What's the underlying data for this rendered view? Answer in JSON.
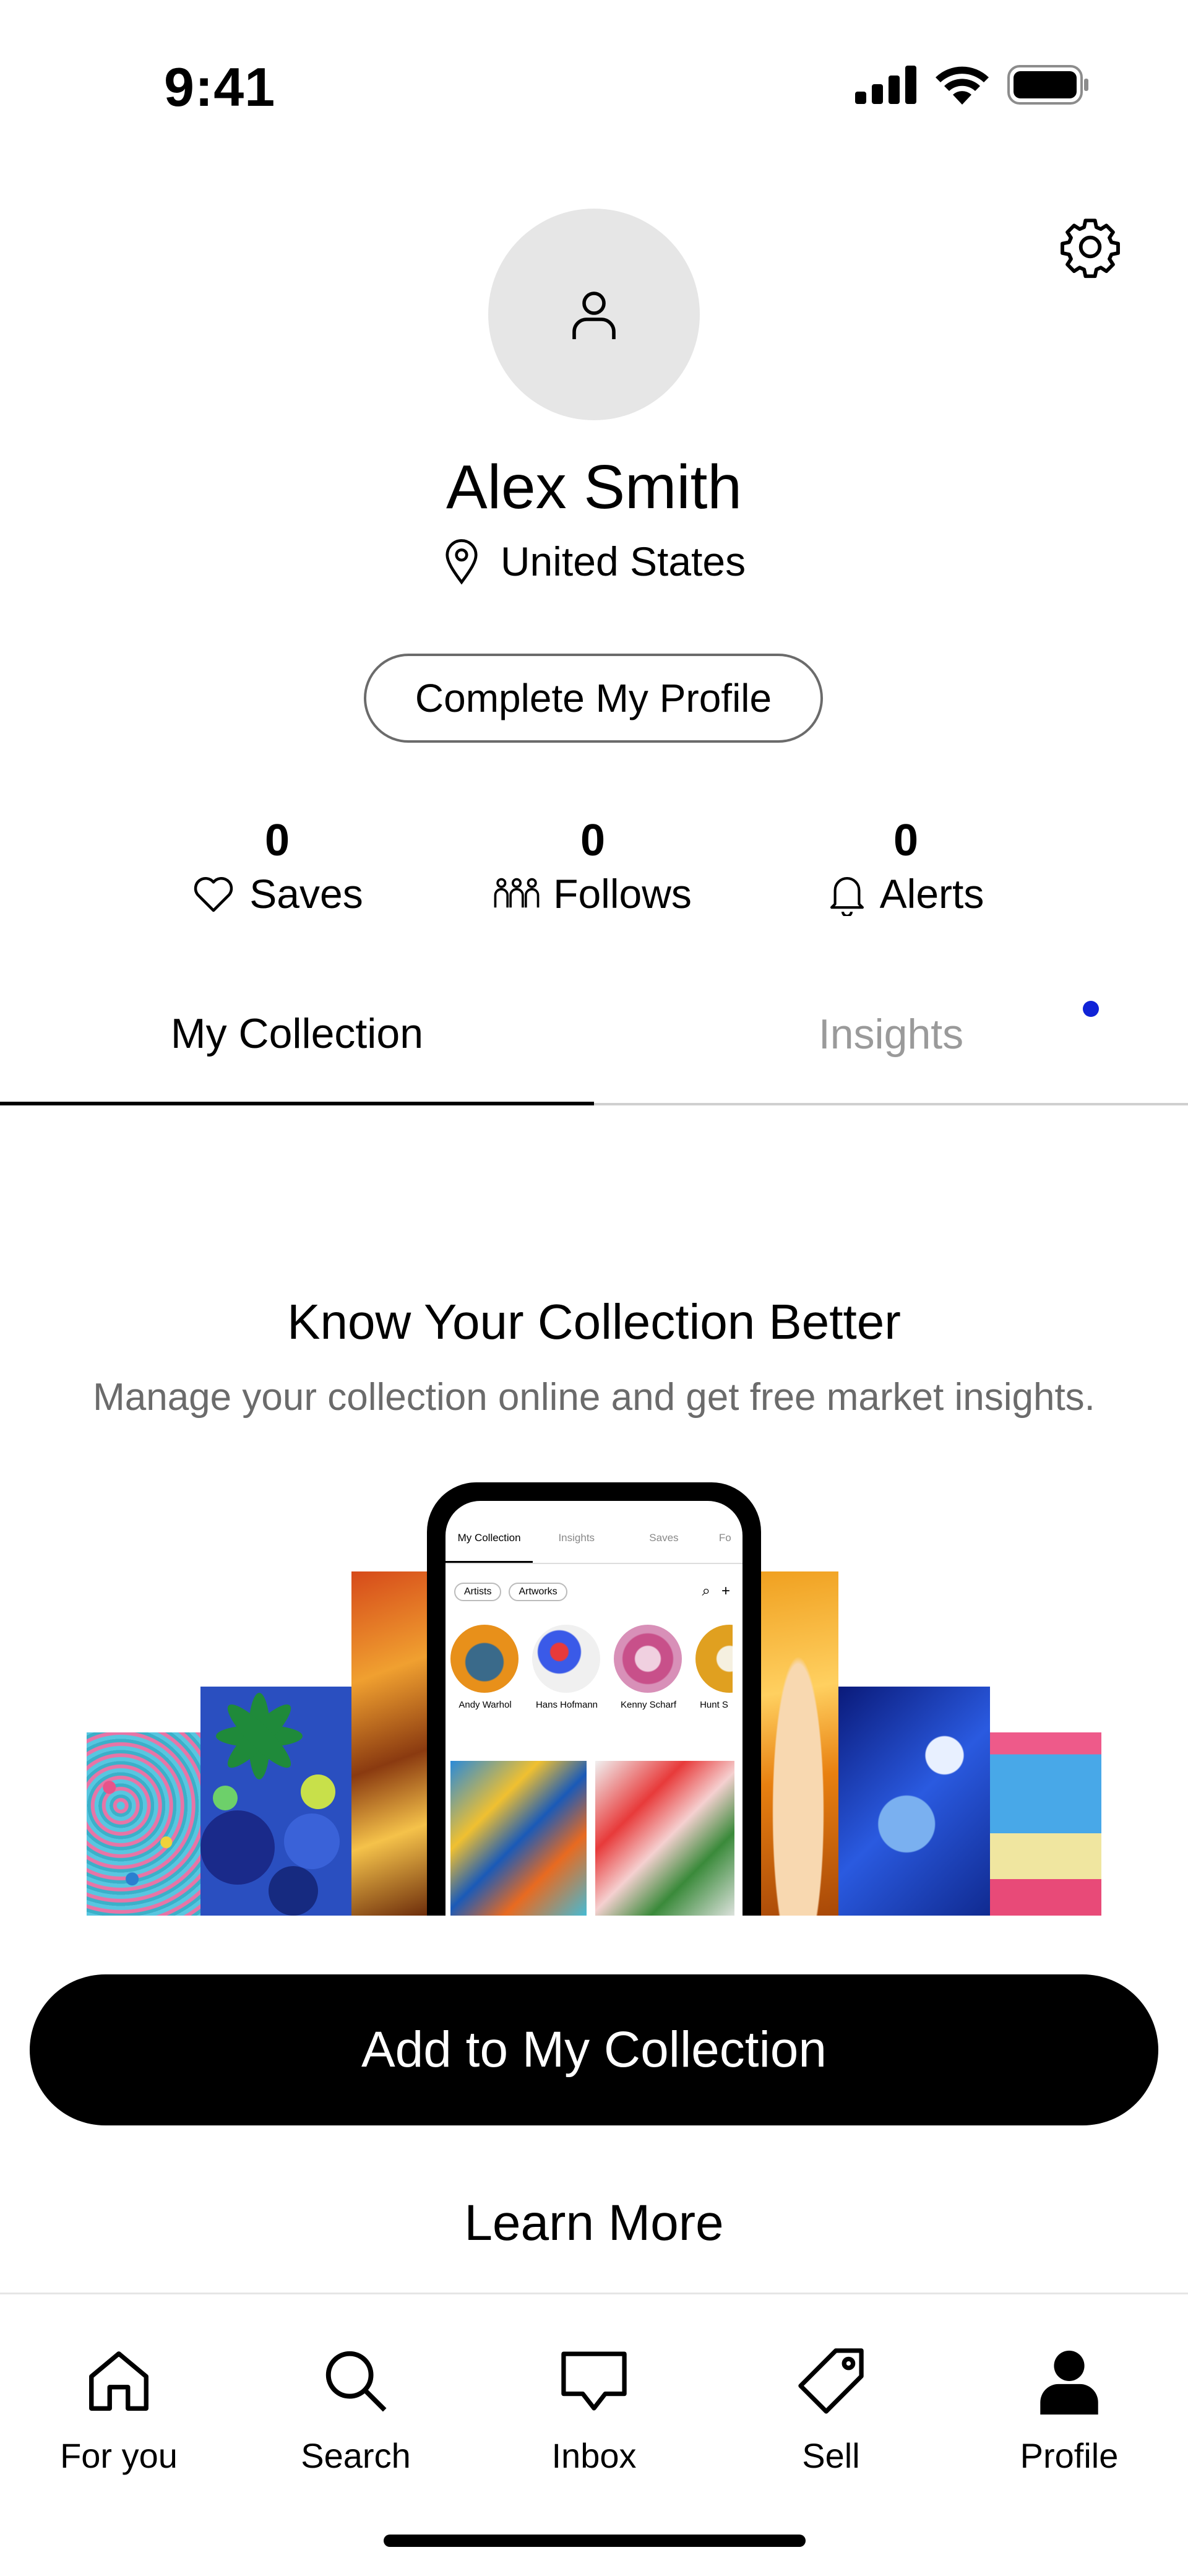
{
  "status_bar": {
    "time": "9:41",
    "icons": [
      "cellular-signal-icon",
      "wifi-icon",
      "battery-icon"
    ]
  },
  "header": {
    "settings_icon": "gear-icon"
  },
  "profile": {
    "avatar_icon": "user-outline-icon",
    "name": "Alex Smith",
    "location": "United States",
    "location_icon": "map-pin-icon",
    "complete_profile_label": "Complete My Profile"
  },
  "stats": [
    {
      "count": "0",
      "label": "Saves",
      "icon": "heart-icon"
    },
    {
      "count": "0",
      "label": "Follows",
      "icon": "people-icon"
    },
    {
      "count": "0",
      "label": "Alerts",
      "icon": "bell-icon"
    }
  ],
  "tabs": [
    {
      "label": "My Collection",
      "active": true
    },
    {
      "label": "Insights",
      "active": false,
      "has_notification_dot": true
    }
  ],
  "promo": {
    "title": "Know Your Collection Better",
    "subtitle": "Manage your collection online and get free market insights.",
    "phone_mockup": {
      "tabs": [
        "My Collection",
        "Insights",
        "Saves",
        "Fo"
      ],
      "chips": [
        "Artists",
        "Artworks"
      ],
      "artists": [
        "Andy Warhol",
        "Hans Hofmann",
        "Kenny Scharf",
        "Hunt S"
      ]
    },
    "add_button_label": "Add to My Collection",
    "learn_more_label": "Learn More"
  },
  "bottom_nav": [
    {
      "label": "For you",
      "icon": "home-icon"
    },
    {
      "label": "Search",
      "icon": "search-icon"
    },
    {
      "label": "Inbox",
      "icon": "inbox-icon"
    },
    {
      "label": "Sell",
      "icon": "tag-icon"
    },
    {
      "label": "Profile",
      "icon": "profile-filled-icon",
      "active": true
    }
  ],
  "colors": {
    "accent_dot": "#1023d7",
    "inactive_tab": "#9a9a9a",
    "avatar_bg": "#e6e6e6"
  }
}
